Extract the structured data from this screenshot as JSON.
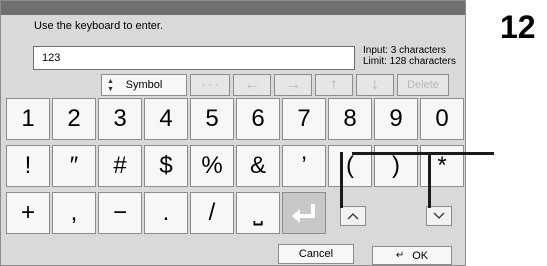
{
  "header": {
    "prompt": "Use the keyboard to enter."
  },
  "input": {
    "value": "123",
    "count_line1": "Input: 3 characters",
    "count_line2": "Limit: 128 characters"
  },
  "toolbar": {
    "symbol_label": "Symbol",
    "dots_label": "- - -",
    "delete_label": "Delete"
  },
  "rows": {
    "row1": [
      "1",
      "2",
      "3",
      "4",
      "5",
      "6",
      "7",
      "8",
      "9",
      "0"
    ],
    "row2": [
      "!",
      "″",
      "#",
      "$",
      "%",
      "&",
      "’",
      "(",
      ")",
      "*"
    ],
    "row3": [
      "+",
      ",",
      "−",
      ".",
      "/",
      "⎵"
    ]
  },
  "footer": {
    "cancel_label": "Cancel",
    "ok_label": "OK"
  },
  "callout": {
    "number": "12"
  }
}
